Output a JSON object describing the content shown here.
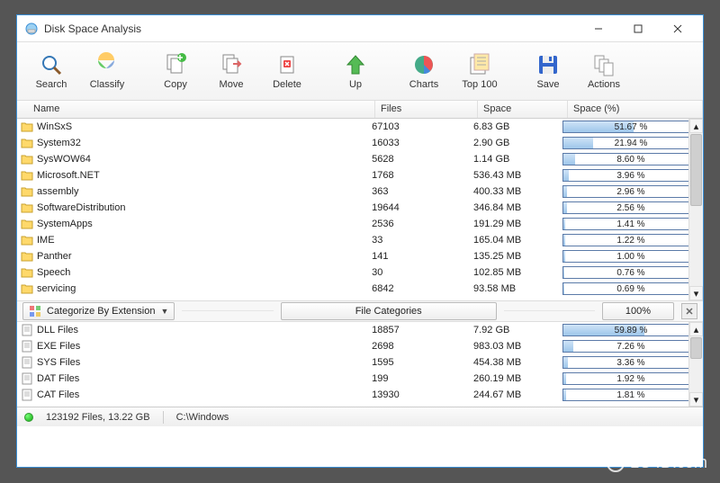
{
  "window": {
    "title": "Disk Space Analysis"
  },
  "toolbar": {
    "search": "Search",
    "classify": "Classify",
    "copy": "Copy",
    "move": "Move",
    "delete": "Delete",
    "up": "Up",
    "charts": "Charts",
    "top100": "Top 100",
    "save": "Save",
    "actions": "Actions"
  },
  "columns": {
    "name": "Name",
    "files": "Files",
    "space": "Space",
    "pct": "Space (%)"
  },
  "folders": [
    {
      "name": "WinSxS",
      "files": "67103",
      "space": "6.83 GB",
      "pct": "51.67 %",
      "fill": 51.67
    },
    {
      "name": "System32",
      "files": "16033",
      "space": "2.90 GB",
      "pct": "21.94 %",
      "fill": 21.94
    },
    {
      "name": "SysWOW64",
      "files": "5628",
      "space": "1.14 GB",
      "pct": "8.60 %",
      "fill": 8.6
    },
    {
      "name": "Microsoft.NET",
      "files": "1768",
      "space": "536.43 MB",
      "pct": "3.96 %",
      "fill": 3.96
    },
    {
      "name": "assembly",
      "files": "363",
      "space": "400.33 MB",
      "pct": "2.96 %",
      "fill": 2.96
    },
    {
      "name": "SoftwareDistribution",
      "files": "19644",
      "space": "346.84 MB",
      "pct": "2.56 %",
      "fill": 2.56
    },
    {
      "name": "SystemApps",
      "files": "2536",
      "space": "191.29 MB",
      "pct": "1.41 %",
      "fill": 1.41
    },
    {
      "name": "IME",
      "files": "33",
      "space": "165.04 MB",
      "pct": "1.22 %",
      "fill": 1.22
    },
    {
      "name": "Panther",
      "files": "141",
      "space": "135.25 MB",
      "pct": "1.00 %",
      "fill": 1.0
    },
    {
      "name": "Speech",
      "files": "30",
      "space": "102.85 MB",
      "pct": "0.76 %",
      "fill": 0.76
    },
    {
      "name": "servicing",
      "files": "6842",
      "space": "93.58 MB",
      "pct": "0.69 %",
      "fill": 0.69
    }
  ],
  "categorize": {
    "dropdown_label": "Categorize By Extension",
    "section_label": "File Categories",
    "zoom": "100%"
  },
  "categories": [
    {
      "name": "DLL Files",
      "files": "18857",
      "space": "7.92 GB",
      "pct": "59.89 %",
      "fill": 59.89
    },
    {
      "name": "EXE Files",
      "files": "2698",
      "space": "983.03 MB",
      "pct": "7.26 %",
      "fill": 7.26
    },
    {
      "name": "SYS Files",
      "files": "1595",
      "space": "454.38 MB",
      "pct": "3.36 %",
      "fill": 3.36
    },
    {
      "name": "DAT Files",
      "files": "199",
      "space": "260.19 MB",
      "pct": "1.92 %",
      "fill": 1.92
    },
    {
      "name": "CAT Files",
      "files": "13930",
      "space": "244.67 MB",
      "pct": "1.81 %",
      "fill": 1.81
    }
  ],
  "status": {
    "summary": "123192 Files, 13.22 GB",
    "path": "C:\\Windows"
  },
  "watermark": "LO4D.com"
}
